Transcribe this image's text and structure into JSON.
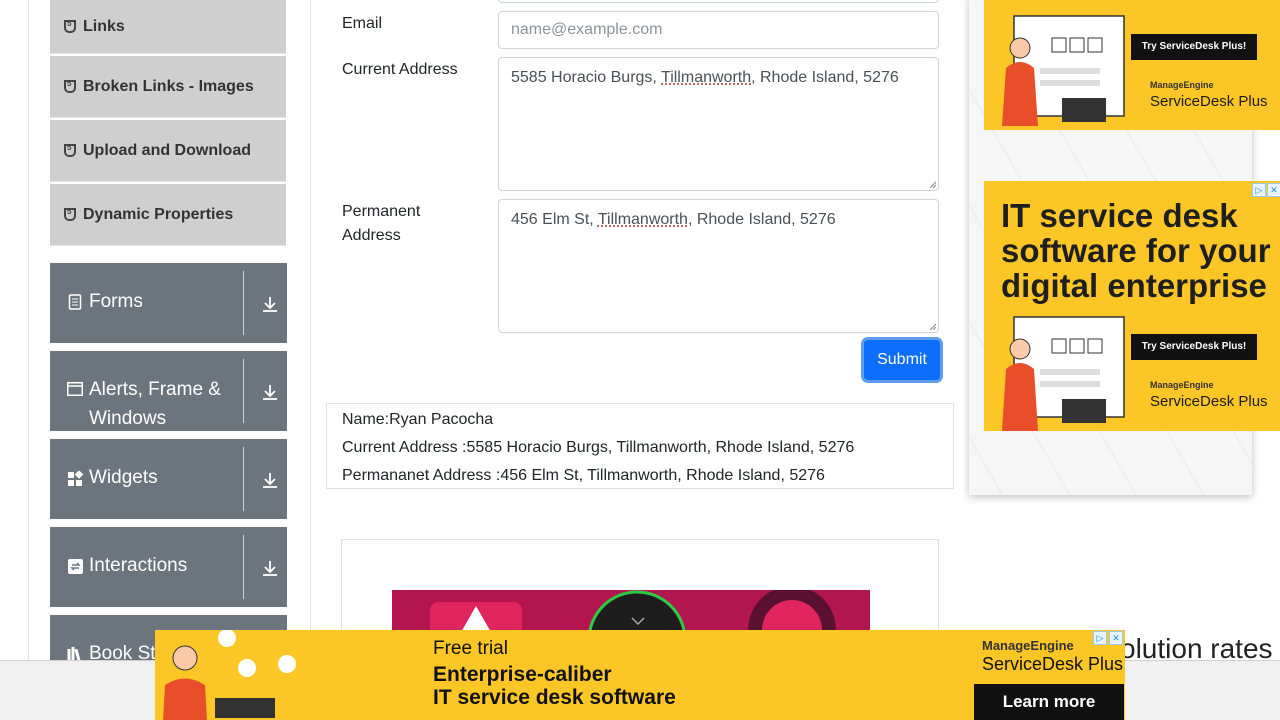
{
  "sidebar": {
    "sub_items": [
      {
        "label": "Links"
      },
      {
        "label": "Broken Links - Images"
      },
      {
        "label": "Upload and Download"
      },
      {
        "label": "Dynamic Properties"
      }
    ],
    "groups": [
      {
        "label": "Forms",
        "icon": "document-icon"
      },
      {
        "label": "Alerts, Frame & Windows",
        "icon": "window-icon"
      },
      {
        "label": "Widgets",
        "icon": "widgets-icon"
      },
      {
        "label": "Interactions",
        "icon": "interactions-icon"
      },
      {
        "label": "Book Store",
        "icon": "books-icon"
      }
    ]
  },
  "form": {
    "email_label": "Email",
    "email_placeholder": "name@example.com",
    "current_address_label": "Current Address",
    "current_address": {
      "before": "5585 Horacio Burgs, ",
      "city": "Tillmanworth",
      "after": ", Rhode Island, 5276"
    },
    "permanent_address_label": "Permanent Address",
    "permanent_address": {
      "before": "456 Elm St, ",
      "city": "Tillmanworth",
      "after": ", Rhode Island, 5276"
    },
    "submit_label": "Submit"
  },
  "output": {
    "name": "Name:Ryan Pacocha",
    "current_address": "Current Address :5585 Horacio Burgs, Tillmanworth, Rhode Island, 5276",
    "permanent_address": "Permananet Address :456 Elm St, Tillmanworth, Rhode Island, 5276"
  },
  "ads": {
    "right_top": {
      "button": "Try ServiceDesk Plus!",
      "brand": "ManageEngine",
      "product": "ServiceDesk Plus"
    },
    "right_bottom": {
      "headline": "IT service desk software for your digital enterprise",
      "button": "Try ServiceDesk Plus!",
      "brand": "ManageEngine",
      "product": "ServiceDesk Plus"
    },
    "bottom": {
      "line1": "Free trial",
      "line2": "Enterprise-caliber",
      "line3": "IT service desk software",
      "brand": "ManageEngine",
      "product": "ServiceDesk Plus",
      "cta": "Learn more"
    },
    "partial_text": "olution rates"
  },
  "colors": {
    "accent": "#0d6efd",
    "group_bg": "#6c757d",
    "ad_yellow": "#fcc726"
  }
}
